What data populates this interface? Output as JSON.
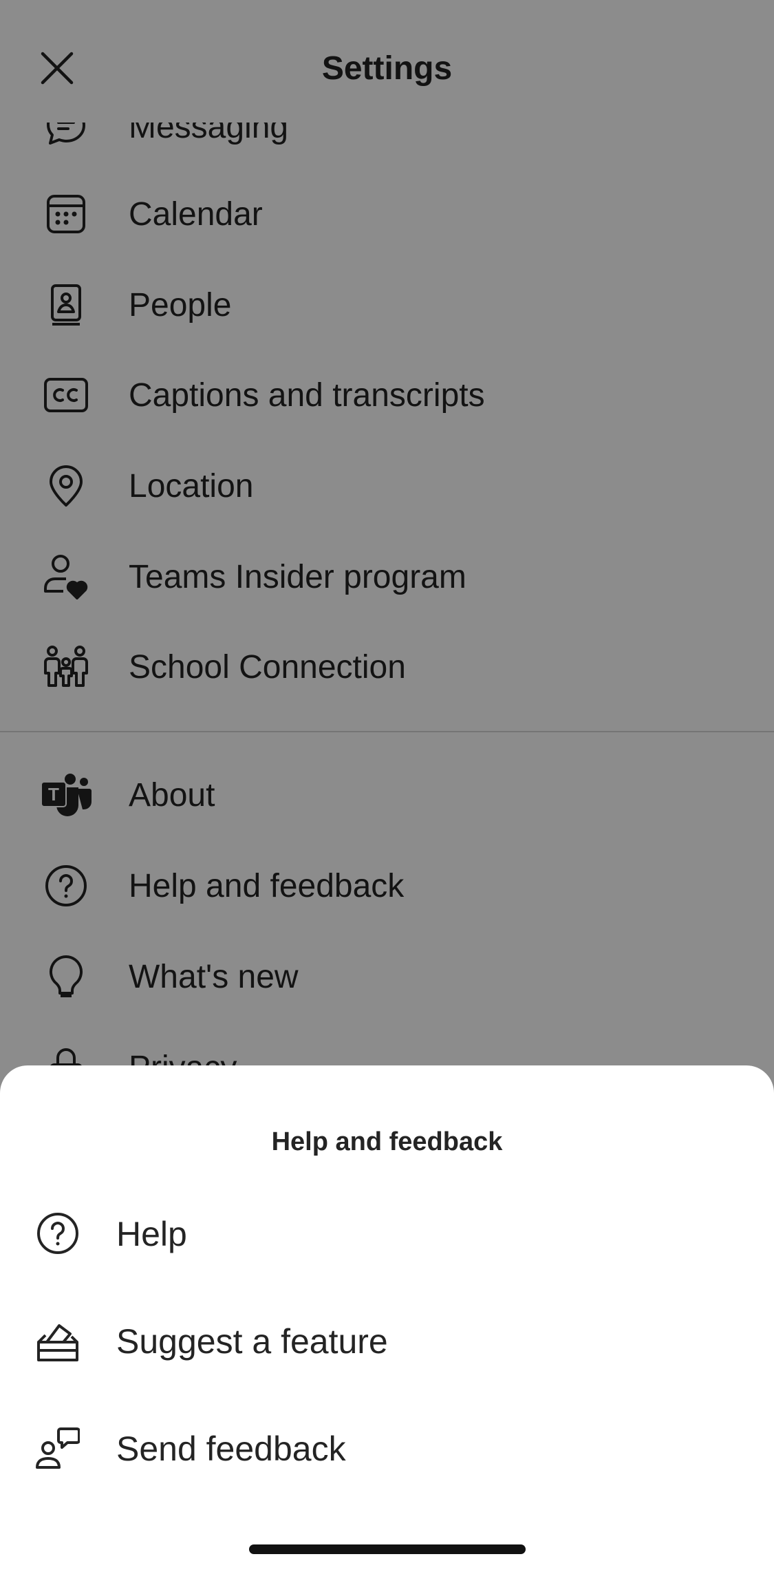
{
  "header": {
    "title": "Settings",
    "close_icon": "close-icon"
  },
  "settings_items": [
    {
      "label": "Messaging",
      "icon": "chat-icon"
    },
    {
      "label": "Calendar",
      "icon": "calendar-icon"
    },
    {
      "label": "People",
      "icon": "contact-book-icon"
    },
    {
      "label": "Captions and transcripts",
      "icon": "closed-captions-icon"
    },
    {
      "label": "Location",
      "icon": "location-pin-icon"
    },
    {
      "label": "Teams Insider program",
      "icon": "person-heart-icon"
    },
    {
      "label": "School Connection",
      "icon": "family-icon"
    },
    {
      "label": "About",
      "icon": "teams-logo-icon"
    },
    {
      "label": "Help and feedback",
      "icon": "question-circle-icon"
    },
    {
      "label": "What's new",
      "icon": "lightbulb-icon"
    },
    {
      "label": "Privacy",
      "icon": "lock-icon"
    }
  ],
  "bottom_sheet": {
    "title": "Help and feedback",
    "items": [
      {
        "label": "Help",
        "icon": "question-circle-icon"
      },
      {
        "label": "Suggest a feature",
        "icon": "ballot-box-icon"
      },
      {
        "label": "Send feedback",
        "icon": "person-feedback-icon"
      }
    ]
  },
  "colors": {
    "text": "#242424",
    "overlay": "rgba(0,0,0,0.45)",
    "sheet_background": "#ffffff"
  }
}
